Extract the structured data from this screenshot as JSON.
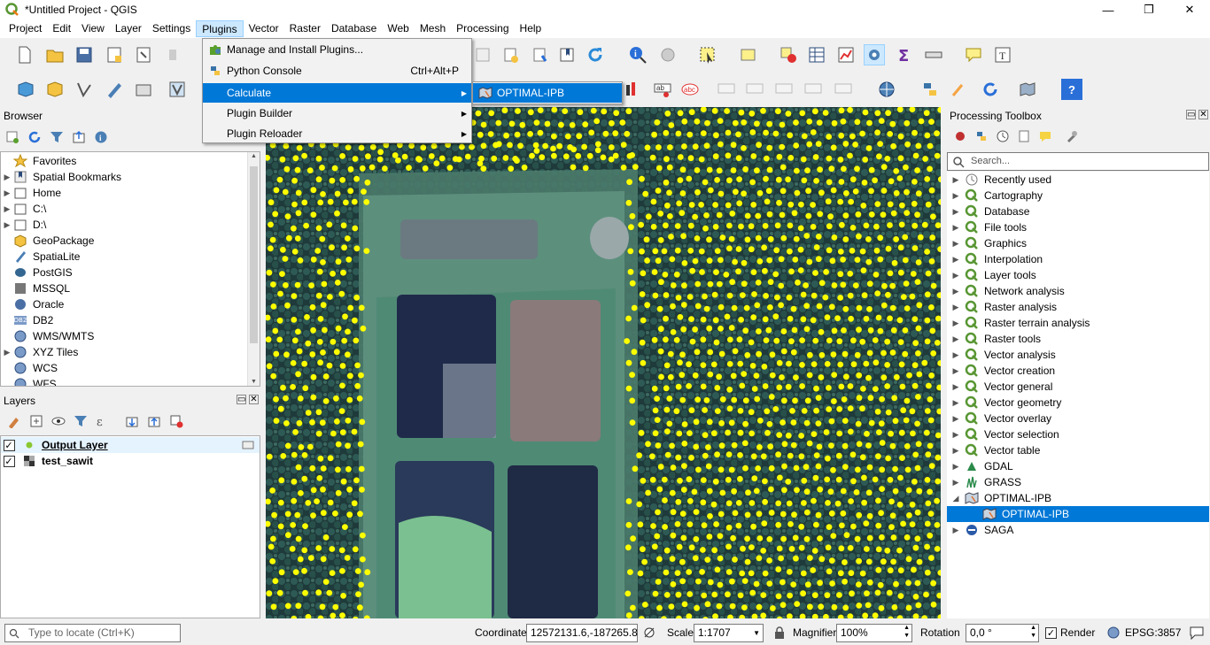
{
  "window": {
    "title": "*Untitled Project - QGIS",
    "minimize": "—",
    "maximize": "❐",
    "close": "✕"
  },
  "menubar": [
    "Project",
    "Edit",
    "View",
    "Layer",
    "Settings",
    "Plugins",
    "Vector",
    "Raster",
    "Database",
    "Web",
    "Mesh",
    "Processing",
    "Help"
  ],
  "plugins_menu": {
    "items": [
      {
        "label": "Manage and Install Plugins...",
        "shortcut": ""
      },
      {
        "label": "Python Console",
        "shortcut": "Ctrl+Alt+P"
      },
      {
        "label": "Calculate",
        "shortcut": ""
      },
      {
        "label": "Plugin Builder",
        "shortcut": ""
      },
      {
        "label": "Plugin Reloader",
        "shortcut": ""
      }
    ],
    "submenu_item": "OPTIMAL-IPB"
  },
  "browser": {
    "title": "Browser",
    "items": [
      "Favorites",
      "Spatial Bookmarks",
      "Home",
      "C:\\",
      "D:\\",
      "GeoPackage",
      "SpatiaLite",
      "PostGIS",
      "MSSQL",
      "Oracle",
      "DB2",
      "WMS/WMTS",
      "XYZ Tiles",
      "WCS",
      "WFS"
    ],
    "db2_badge": "DB2"
  },
  "layers": {
    "title": "Layers",
    "items": [
      {
        "name": "Output Layer",
        "checked": true
      },
      {
        "name": "test_sawit",
        "checked": true
      }
    ]
  },
  "toolbox": {
    "title": "Processing Toolbox",
    "search_placeholder": "Search...",
    "items": [
      "Recently used",
      "Cartography",
      "Database",
      "File tools",
      "Graphics",
      "Interpolation",
      "Layer tools",
      "Network analysis",
      "Raster analysis",
      "Raster terrain analysis",
      "Raster tools",
      "Vector analysis",
      "Vector creation",
      "Vector general",
      "Vector geometry",
      "Vector overlay",
      "Vector selection",
      "Vector table",
      "GDAL",
      "GRASS",
      "OPTIMAL-IPB",
      "OPTIMAL-IPB",
      "SAGA"
    ]
  },
  "statusbar": {
    "locate_placeholder": "Type to locate (Ctrl+K)",
    "coordinate_label": "Coordinate",
    "coordinate_value": "12572131.6,-187265.8",
    "scale_label": "Scale",
    "scale_value": "1:1707",
    "magnifier_label": "Magnifier",
    "magnifier_value": "100%",
    "rotation_label": "Rotation",
    "rotation_value": "0,0 °",
    "render_label": "Render",
    "crs": "EPSG:3857"
  },
  "colors": {
    "accent": "#0078d7",
    "point": "#ffff00",
    "menu_active": "#cce8ff"
  }
}
